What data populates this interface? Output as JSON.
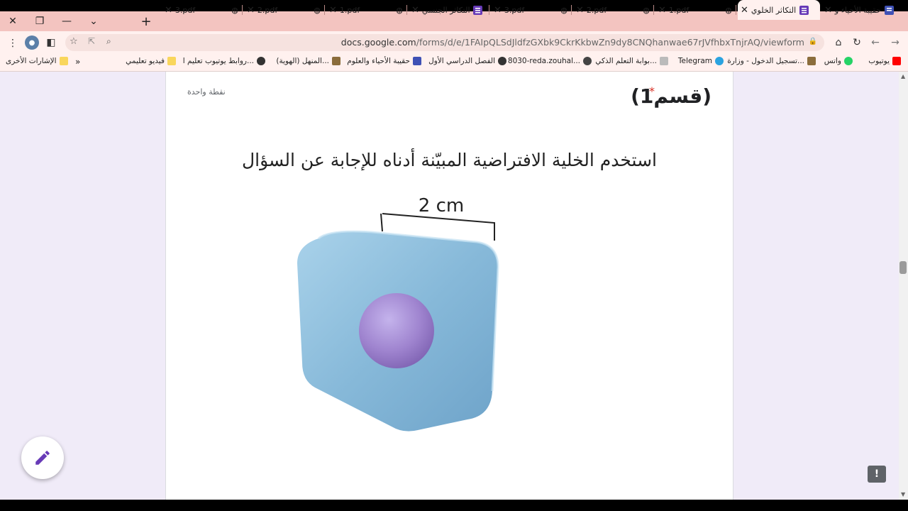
{
  "tabs": [
    {
      "label": "حقيبة الأحياء و",
      "active": false
    },
    {
      "label": "التكاثر الخلوي",
      "active": true
    },
    {
      "label": "1.pdf",
      "active": false
    },
    {
      "label": "2.pdf",
      "active": false
    },
    {
      "label": "3.pdf",
      "active": false
    },
    {
      "label": "التكاثر الجنسي",
      "active": false
    },
    {
      "label": "1.pdf",
      "active": false
    },
    {
      "label": "2.pdf",
      "active": false
    },
    {
      "label": "3.pdf",
      "active": false
    }
  ],
  "url": {
    "host": "docs.google.com",
    "path": "/forms/d/e/1FAIpQLSdJldfzGXbk9CkrKkbwZn9dy8CNQhanwae67rJVfhbxTnjrAQ/viewform"
  },
  "bookmarks": [
    {
      "label": "يوتيوب",
      "color": "#ff0000"
    },
    {
      "label": "واتس",
      "color": "#25d366"
    },
    {
      "label": "تسجيل الدخول - وزارة...",
      "color": "#8b6d3c"
    },
    {
      "label": "Telegram",
      "color": "#2aa3e0"
    },
    {
      "label": "بوابة التعلم الذكي...",
      "color": "#bbbbbb"
    },
    {
      "label": "8030-reda.zouhal...",
      "color": "#444444"
    },
    {
      "label": "الفصل الدراسي الأول",
      "color": "#333333"
    },
    {
      "label": "حقيبة الأحياء والعلوم",
      "color": "#3f51b5"
    },
    {
      "label": "المنهل (الهوية)...",
      "color": "#8b6d3c"
    },
    {
      "label": "روابط يوتيوب تعليم ا...",
      "color": "#333333"
    },
    {
      "label": "فيديو تعليمي",
      "color": "#f9d65c"
    },
    {
      "label": "الإشارات الأخرى",
      "color": "#f9d65c"
    }
  ],
  "question": {
    "title": "(قسم1)",
    "required_mark": "*",
    "points": "نقطة واحدة",
    "instruction": "استخدم الخلية الافتراضية المبيّنة أدناه للإجابة عن السؤال",
    "measure_label": "2 cm"
  },
  "colors": {
    "accent": "#673ab7",
    "required": "#d93025",
    "cube": "#8dbfdd",
    "nucleus": "#9f84cf"
  }
}
